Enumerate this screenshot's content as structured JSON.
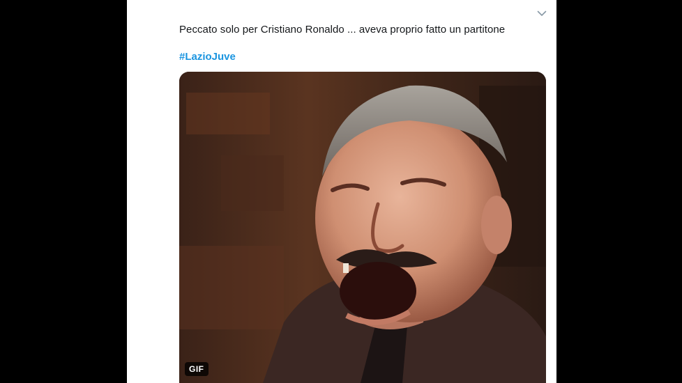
{
  "tweet": {
    "text": "Peccato solo per Cristiano Ronaldo ... aveva proprio fatto un partitone",
    "hashtag": "#LazioJuve",
    "more_icon": "chevron-down-icon"
  },
  "media": {
    "badge": "GIF"
  },
  "colors": {
    "background": "#000000",
    "card": "#ffffff",
    "text": "#14171a",
    "hashtag": "#1b95e0",
    "icon": "#8899a6"
  }
}
